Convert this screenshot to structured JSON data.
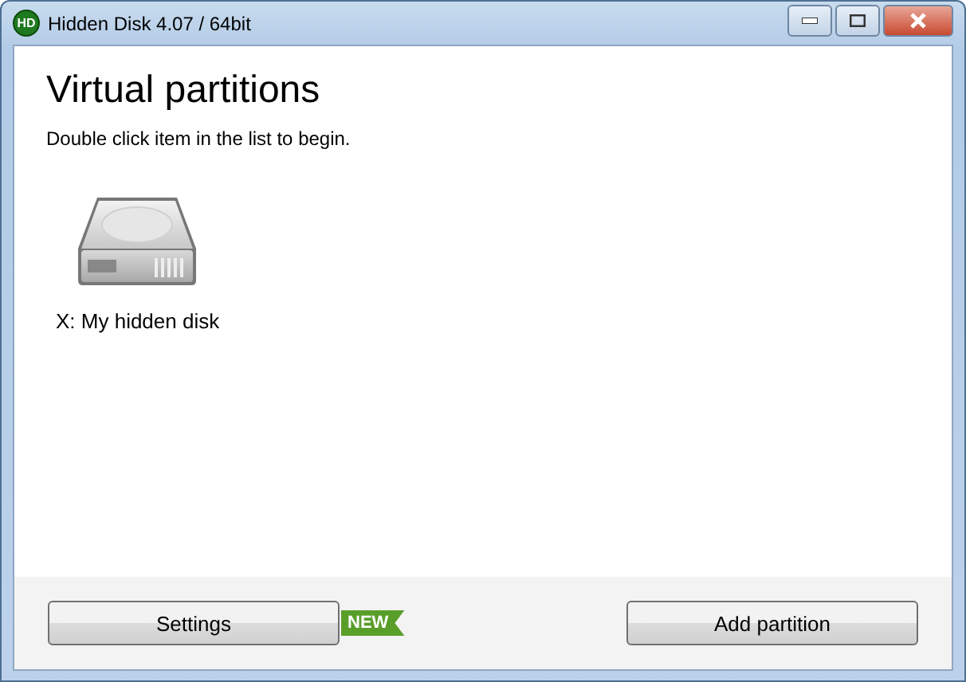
{
  "window": {
    "title": "Hidden Disk 4.07 / 64bit",
    "logo": "HD"
  },
  "heading": "Virtual partitions",
  "hint": "Double click item in the list to begin.",
  "partitions": [
    {
      "label": "X: My hidden disk"
    }
  ],
  "footer": {
    "settings": "Settings",
    "badge": "NEW",
    "add": "Add partition"
  }
}
